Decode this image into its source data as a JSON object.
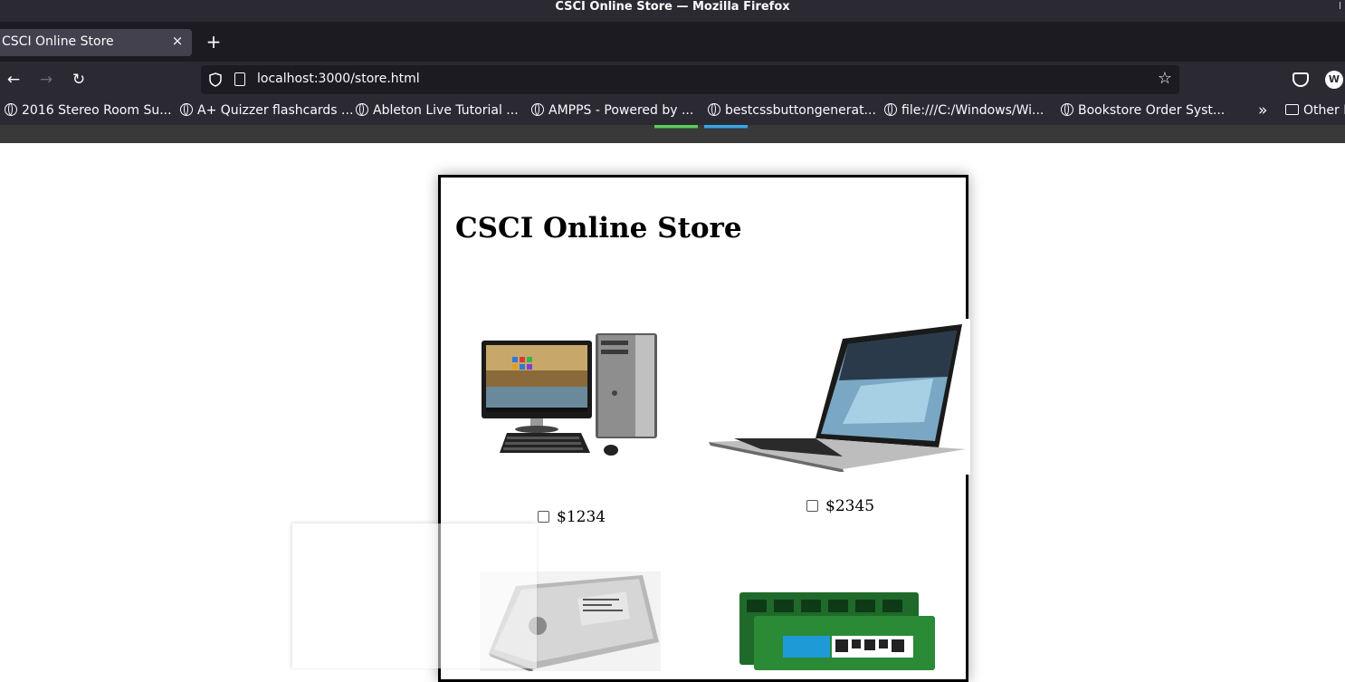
{
  "window": {
    "title": "CSCI Online Store — Mozilla Firefox"
  },
  "tabs": [
    {
      "label": "CSCI Online Store",
      "close": "×"
    }
  ],
  "new_tab": "+",
  "nav": {
    "back": "←",
    "forward": "→",
    "reload": "↻"
  },
  "urlbar": {
    "url": "localhost:3000/store.html",
    "star": "☆"
  },
  "account_initial": "W",
  "bookmarks": [
    {
      "label": "2016 Stereo Room Su..."
    },
    {
      "label": "A+ Quizzer flashcards ..."
    },
    {
      "label": "Ableton Live Tutorial ..."
    },
    {
      "label": "AMPPS - Powered by ..."
    },
    {
      "label": "bestcssbuttongenerat..."
    },
    {
      "label": "file:///C:/Windows/Wi..."
    },
    {
      "label": "Bookstore Order Syst..."
    }
  ],
  "bookmarks_overflow": "»",
  "bookmarks_other": "Other B",
  "store": {
    "title": "CSCI Online Store",
    "products": [
      {
        "price": "$1234",
        "image": "desktop-computer-image",
        "checked": false
      },
      {
        "price": "$2345",
        "image": "laptop-image",
        "checked": false
      },
      {
        "price": "",
        "image": "hard-drive-image",
        "checked": false
      },
      {
        "price": "",
        "image": "ram-module-image",
        "checked": false
      }
    ]
  }
}
